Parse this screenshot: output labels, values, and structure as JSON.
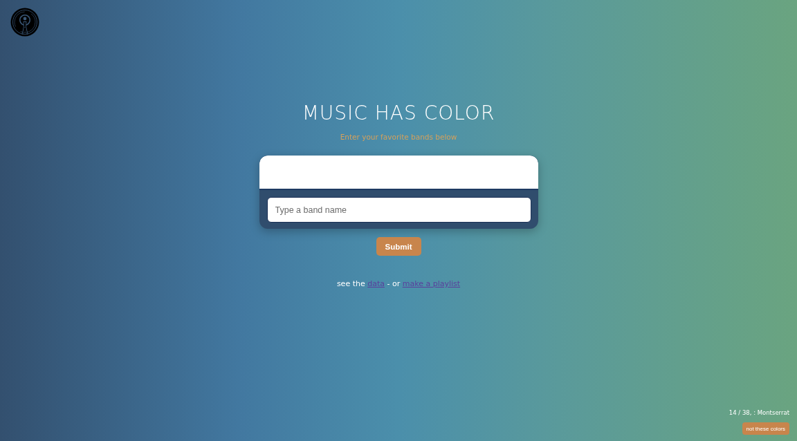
{
  "header": {
    "title": "MUSIC HAS COLOR",
    "subtitle": "Enter your favorite bands below"
  },
  "band_form": {
    "input": {
      "placeholder": "Type a band name"
    },
    "submit": "Submit"
  },
  "links_line": {
    "parts": [
      {
        "kind": "text",
        "text": "see the"
      },
      {
        "kind": "link",
        "text": "data"
      },
      {
        "kind": "text",
        "text": "- or"
      },
      {
        "kind": "link",
        "text": "make a playlist"
      }
    ]
  },
  "footer": {
    "font_info": "14 / 38, : Montserrat",
    "button": "not these colors"
  }
}
